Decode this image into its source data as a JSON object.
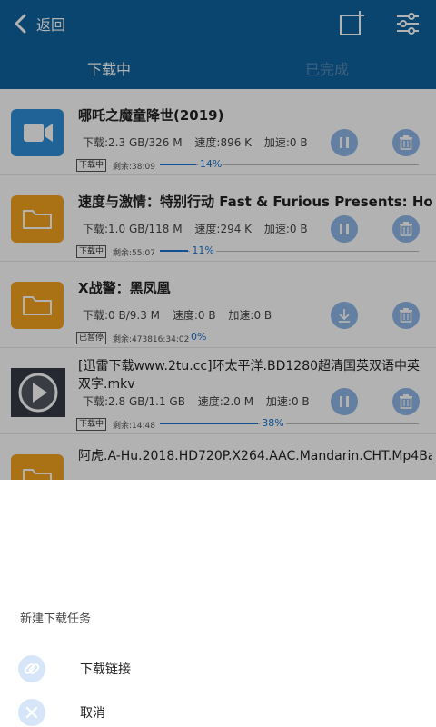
{
  "header": {
    "back_label": "返回",
    "tabs": [
      {
        "label": "下载中"
      },
      {
        "label": "已完成"
      }
    ]
  },
  "downloads": [
    {
      "title": "哪吒之魔童降世(2019)",
      "icon": "video-camera-icon",
      "downloaded": "下载:2.3 GB/326 M",
      "speed": "速度:896 K",
      "accel": "加速:0 B",
      "badge": "下载中",
      "remaining": "剩余:38:09",
      "percent_text": "14%",
      "progress": 0.14,
      "action": "pause"
    },
    {
      "title": "速度与激情：特别行动 Fast & Furious Presents: Hobbs",
      "icon": "folder-icon",
      "downloaded": "下载:1.0 GB/118 M",
      "speed": "速度:294 K",
      "accel": "加速:0 B",
      "badge": "下载中",
      "remaining": "剩余:55:07",
      "percent_text": "11%",
      "progress": 0.11,
      "action": "pause"
    },
    {
      "title": "X战警：黑凤凰",
      "icon": "folder-icon",
      "downloaded": "下载:0 B/9.3 M",
      "speed": "速度:0 B",
      "accel": "加速:0 B",
      "badge": "已暂停",
      "remaining": "剩余:473816:34:02",
      "percent_text": "0%",
      "progress": 0.0,
      "action": "resume"
    },
    {
      "title": "[迅雷下载www.2tu.cc]环太平洋.BD1280超清国英双语中英双字.mkv",
      "icon": "movie-thumbnail-icon",
      "downloaded": "下载:2.8 GB/1.1 GB",
      "speed": "速度:2.0 M",
      "accel": "加速:0 B",
      "badge": "下载中",
      "remaining": "剩余:14:48",
      "percent_text": "38%",
      "progress": 0.38,
      "action": "pause"
    },
    {
      "title": "阿虎.A-Hu.2018.HD720P.X264.AAC.Mandarin.CHT.Mp4Ba",
      "icon": "folder-icon"
    }
  ],
  "sheet": {
    "title": "新建下载任务",
    "link_label": "下载链接",
    "cancel_label": "取消"
  },
  "colors": {
    "header": "#0e63a0",
    "progress": "#1a73d1",
    "folder": "#f4a21f",
    "video": "#2f8fd9",
    "button": "#8fb6e8"
  }
}
